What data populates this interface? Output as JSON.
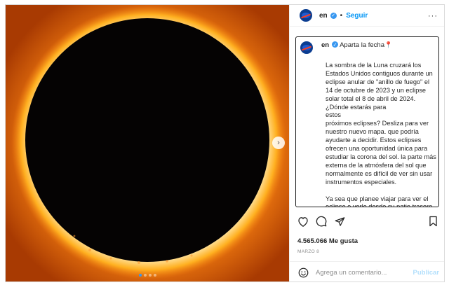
{
  "post": {
    "image_alt": "Annular solar eclipse — ring of fire",
    "carousel": {
      "total": 4,
      "active": 0
    },
    "next_glyph": "›"
  },
  "header": {
    "username": "en",
    "separator": "•",
    "follow_label": "Seguir",
    "more_glyph": "···"
  },
  "caption": {
    "username": "en",
    "headline": "Aparta la fecha",
    "headline_emoji": "📍",
    "body": "La sombra de la Luna cruzará los Estados Unidos contiguos durante un eclipse anular de \"anillo de fuego\" el 14 de octubre de 2023 y un eclipse solar total el 8 de abril de 2024.\n¿Dónde estarás para\nestos\npróximos eclipses? Desliza para ver nuestro nuevo mapa. que podría ayudarte a decidir. Estos eclipses ofrecen una oportunidad única para estudiar la corona del sol. la parte más externa de la atmósfera del sol que normalmente es difícil de ver sin usar instrumentos especiales.\n\nYa sea que planee viajar para ver el eclipse o verlo desde su patio trasero"
  },
  "stats": {
    "likes": "4.565.066 Me gusta",
    "date": "MARZO 8"
  },
  "comment": {
    "placeholder": "Agrega un comentario...",
    "publish_label": "Publicar"
  },
  "colors": {
    "accent": "#0095f6",
    "verified": "#3897f0",
    "publish_disabled": "#b2dffc",
    "eclipse_ring": "#ff7a00"
  }
}
